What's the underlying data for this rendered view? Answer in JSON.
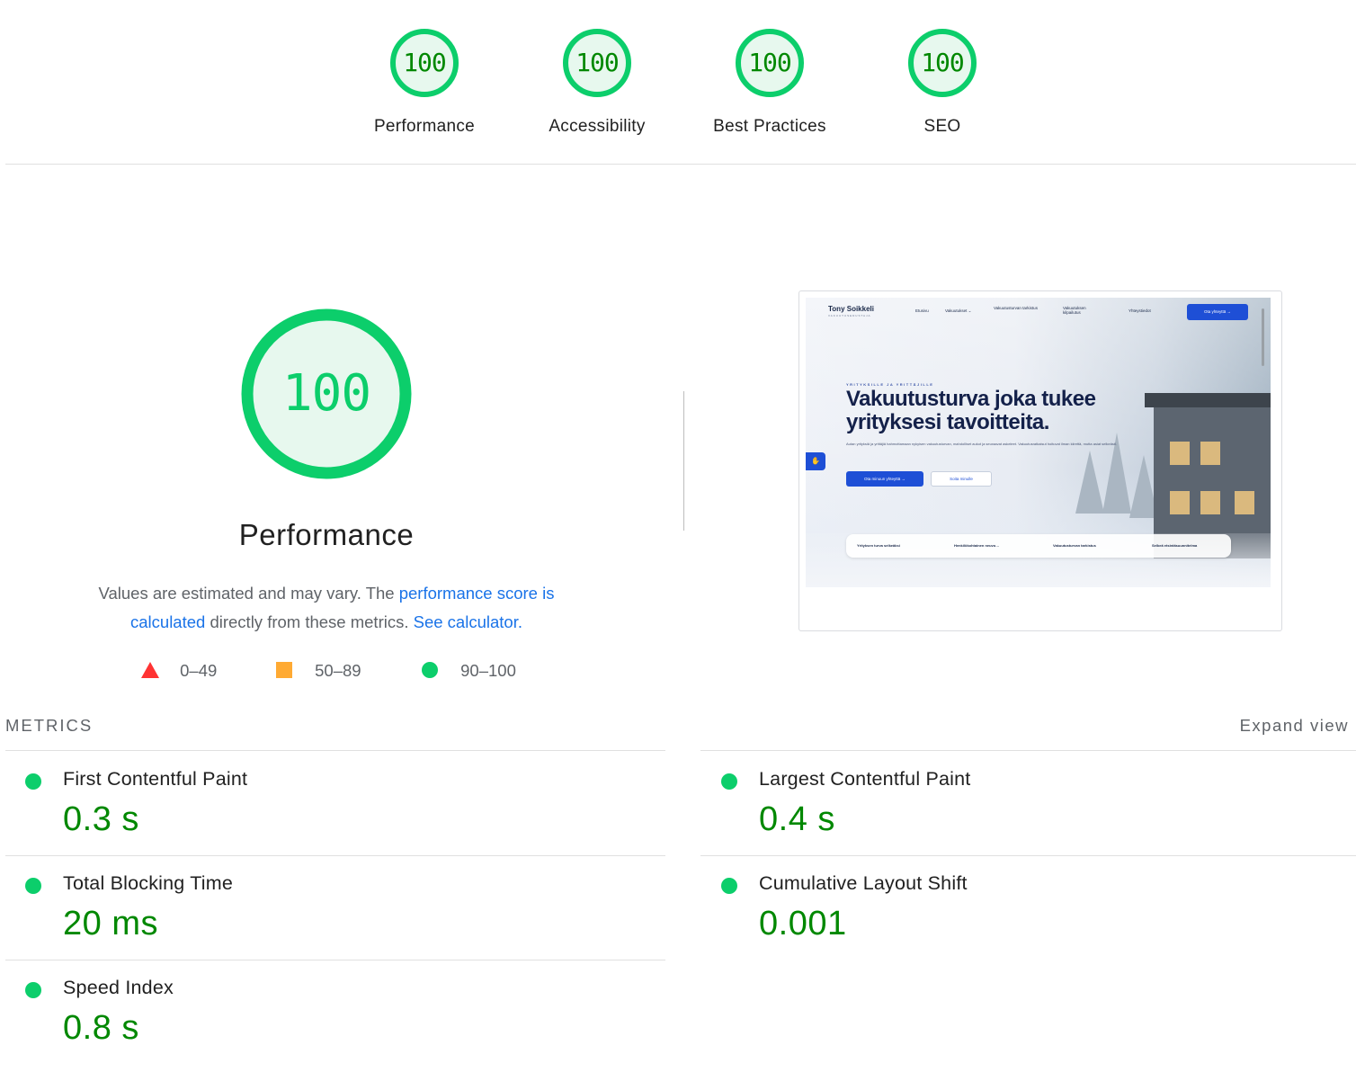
{
  "colors": {
    "pass": "#0cce6b",
    "pass_text": "#008800",
    "average": "#ffaa33",
    "fail": "#ff3333",
    "link": "#1a73e8"
  },
  "gauges": [
    {
      "score": "100",
      "label": "Performance"
    },
    {
      "score": "100",
      "label": "Accessibility"
    },
    {
      "score": "100",
      "label": "Best Practices"
    },
    {
      "score": "100",
      "label": "SEO"
    }
  ],
  "performance": {
    "score": "100",
    "title": "Performance",
    "desc_prefix": "Values are estimated and may vary. The ",
    "desc_link": "performance score is calculated",
    "desc_mid": " directly from these metrics. ",
    "desc_calc": "See calculator."
  },
  "legend": [
    {
      "icon": "fail-triangle-icon",
      "range": "0–49"
    },
    {
      "icon": "average-square-icon",
      "range": "50–89"
    },
    {
      "icon": "pass-circle-icon",
      "range": "90–100"
    }
  ],
  "screenshot": {
    "brand": "Tony Soikkeli",
    "brand_sub": "VAKUUTUSEDUSTAJA",
    "nav": [
      "Etusivu",
      "Vakuutukset ⌄",
      "Vakuutusturvan tarkistus",
      "Vakuutuksen kilpailutus",
      "Yhteystiedot"
    ],
    "nav_button": "Ota yhteyttä →",
    "kicker": "YRITYKSILLE JA YRITTÄJILLE",
    "headline": "Vakuutusturva joka tukee yrityksesi tavoitteita.",
    "subtext": "Autan yrityksiä ja yrittäjiä hahmottamaan nykyisen vakuutusturvan, mahdolliset aukot ja seuraavat askeleet. Vakuutusratkaisut hoituvat ilman kiirettä, mutta asiat selkeästi.",
    "primary_cta": "Ota minuun yhteyttä →",
    "secondary_cta": "Soita minulle",
    "features": [
      "Yrityksen turva selkeäksi",
      "Henkilökohtainen neuvo…",
      "Vakuutusturvan tarkistus",
      "Selkeä etsintäsuunnitelma"
    ]
  },
  "metrics_section": {
    "heading": "METRICS",
    "expand": "Expand view",
    "items": [
      {
        "title": "First Contentful Paint",
        "value": "0.3 s"
      },
      {
        "title": "Largest Contentful Paint",
        "value": "0.4 s"
      },
      {
        "title": "Total Blocking Time",
        "value": "20 ms"
      },
      {
        "title": "Cumulative Layout Shift",
        "value": "0.001"
      },
      {
        "title": "Speed Index",
        "value": "0.8 s"
      }
    ]
  }
}
